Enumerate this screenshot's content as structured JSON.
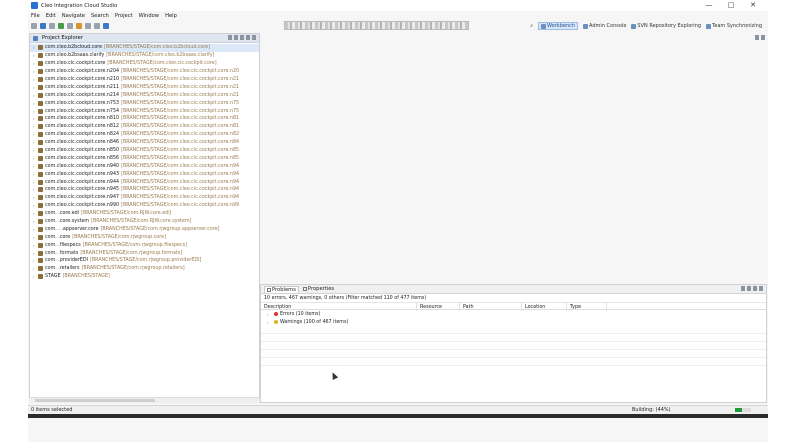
{
  "window": {
    "title": "Cleo Integration Cloud Studio",
    "controls": [
      "—",
      "□",
      "✕"
    ]
  },
  "menu": [
    "File",
    "Edit",
    "Navigate",
    "Search",
    "Project",
    "Window",
    "Help"
  ],
  "perspectives": [
    {
      "label": "Workbench",
      "active": true,
      "icon": "workbench-icon"
    },
    {
      "label": "Admin Console",
      "active": false,
      "icon": "admin-console-icon"
    },
    {
      "label": "SVN Repository Exploring",
      "active": false,
      "icon": "svn-icon"
    },
    {
      "label": "Team Synchronizing",
      "active": false,
      "icon": "team-sync-icon"
    }
  ],
  "project_explorer": {
    "title": "Project Explorer",
    "items": [
      {
        "name": "com.cleo.b2bcloud.core",
        "branch": "[BRANCHES/STAGE/com.cleo.b2bcloud.core]",
        "selected": true
      },
      {
        "name": "com.cleo.b2bsaas.clarify",
        "branch": "[BRANCHES/STAGE/com.cleo.b2bsaas.clarify]"
      },
      {
        "name": "com.cleo.cic.cockpit.core",
        "branch": "[BRANCHES/STAGE/com.cleo.cic.cockpit.core]"
      },
      {
        "name": "com.cleo.cic.cockpit.core.n204",
        "branch": "[BRANCHES/STAGE/com.cleo.cic.cockpit.core.n20"
      },
      {
        "name": "com.cleo.cic.cockpit.core.n210",
        "branch": "[BRANCHES/STAGE/com.cleo.cic.cockpit.core.n21"
      },
      {
        "name": "com.cleo.cic.cockpit.core.n211",
        "branch": "[BRANCHES/STAGE/com.cleo.cic.cockpit.core.n21"
      },
      {
        "name": "com.cleo.cic.cockpit.core.n214",
        "branch": "[BRANCHES/STAGE/com.cleo.cic.cockpit.core.n21"
      },
      {
        "name": "com.cleo.cic.cockpit.core.n753",
        "branch": "[BRANCHES/STAGE/com.cleo.cic.cockpit.core.n75"
      },
      {
        "name": "com.cleo.cic.cockpit.core.n754",
        "branch": "[BRANCHES/STAGE/com.cleo.cic.cockpit.core.n75"
      },
      {
        "name": "com.cleo.cic.cockpit.core.n810",
        "branch": "[BRANCHES/STAGE/com.cleo.cic.cockpit.core.n81"
      },
      {
        "name": "com.cleo.cic.cockpit.core.n812",
        "branch": "[BRANCHES/STAGE/com.cleo.cic.cockpit.core.n81"
      },
      {
        "name": "com.cleo.cic.cockpit.core.n824",
        "branch": "[BRANCHES/STAGE/com.cleo.cic.cockpit.core.n82"
      },
      {
        "name": "com.cleo.cic.cockpit.core.n846",
        "branch": "[BRANCHES/STAGE/com.cleo.cic.cockpit.core.n84"
      },
      {
        "name": "com.cleo.cic.cockpit.core.n850",
        "branch": "[BRANCHES/STAGE/com.cleo.cic.cockpit.core.n85"
      },
      {
        "name": "com.cleo.cic.cockpit.core.n856",
        "branch": "[BRANCHES/STAGE/com.cleo.cic.cockpit.core.n85"
      },
      {
        "name": "com.cleo.cic.cockpit.core.n940",
        "branch": "[BRANCHES/STAGE/com.cleo.cic.cockpit.core.n94"
      },
      {
        "name": "com.cleo.cic.cockpit.core.n943",
        "branch": "[BRANCHES/STAGE/com.cleo.cic.cockpit.core.n94"
      },
      {
        "name": "com.cleo.cic.cockpit.core.n944",
        "branch": "[BRANCHES/STAGE/com.cleo.cic.cockpit.core.n94"
      },
      {
        "name": "com.cleo.cic.cockpit.core.n945",
        "branch": "[BRANCHES/STAGE/com.cleo.cic.cockpit.core.n94"
      },
      {
        "name": "com.cleo.cic.cockpit.core.n947",
        "branch": "[BRANCHES/STAGE/com.cleo.cic.cockpit.core.n94"
      },
      {
        "name": "com.cleo.cic.cockpit.core.n990",
        "branch": "[BRANCHES/STAGE/com.cleo.cic.cockpit.core.n99"
      },
      {
        "name": "com.      .core.edi",
        "branch": "[BRANCHES/STAGE/com.RJW.core.edi]"
      },
      {
        "name": "com.      .core.system",
        "branch": "[BRANCHES/STAGE/com.RJW.core.system]"
      },
      {
        "name": "com.   .    .appserver.core",
        "branch": "[BRANCHES/STAGE/com.rjwgroup.appserver.core]"
      },
      {
        "name": "com.     .core",
        "branch": "[BRANCHES/STAGE/com.rjwgroup.core]"
      },
      {
        "name": "com.       .filespecs",
        "branch": "[BRANCHES/STAGE/com.rjwgroup.filespecs]"
      },
      {
        "name": "com.       .formats",
        "branch": "[BRANCHES/STAGE/com.rjwgroup.formats]"
      },
      {
        "name": "com.       .providerEDI",
        "branch": "[BRANCHES/STAGE/com.rjwgroup.providerEDI]"
      },
      {
        "name": "com.       .retailers",
        "branch": "[BRANCHES/STAGE/com.rjwgroup.retailers]"
      },
      {
        "name": "STAGE",
        "branch": "[BRANCHES/STAGE]"
      }
    ]
  },
  "problems": {
    "tabs": [
      {
        "label": "Problems",
        "active": true
      },
      {
        "label": "Properties",
        "active": false
      }
    ],
    "summary": "10 errors, 467 warnings, 0 others (Filter matched 110 of 477 items)",
    "columns": [
      "Description",
      "Resource",
      "Path",
      "Location",
      "Type"
    ],
    "rows": [
      {
        "label": "Errors (10 items)",
        "kind": "error"
      },
      {
        "label": "Warnings (100 of 467 items)",
        "kind": "warning"
      }
    ]
  },
  "status": {
    "left": "0 items selected",
    "building": "Building: (44%)",
    "progress": 0.44
  },
  "colors": {
    "accent": "#2a6fd6",
    "error": "#dd3333",
    "warning": "#e2b320",
    "progress": "#1e9b3a"
  }
}
